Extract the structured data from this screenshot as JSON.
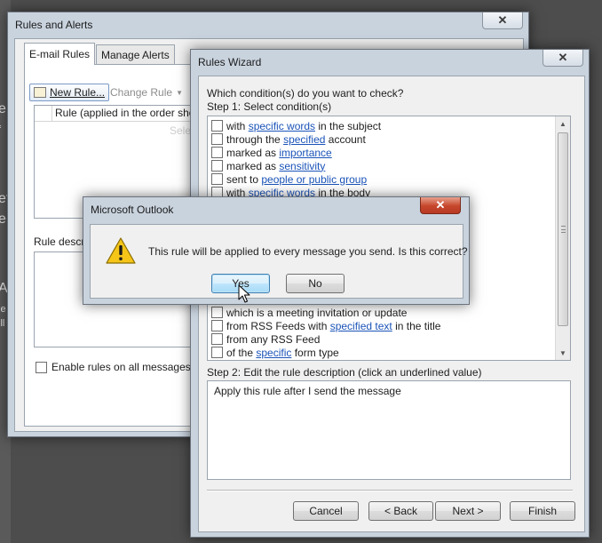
{
  "background_fragments": [
    "e",
    "f",
    "et",
    "e",
    "A",
    "le",
    "ill"
  ],
  "rules_alerts": {
    "title": "Rules and Alerts",
    "tabs": [
      "E-mail Rules",
      "Manage Alerts"
    ],
    "new_rule": "New Rule...",
    "change_rule": "Change Rule",
    "rule_column_header": "Rule (applied in the order shown)",
    "faded_text": "Select",
    "description_label": "Rule descrip",
    "enable_label": "Enable rules on all messages dow"
  },
  "wizard": {
    "title": "Rules Wizard",
    "question": "Which condition(s) do you want to check?",
    "step1": "Step 1: Select condition(s)",
    "conditions": [
      {
        "pre": "with ",
        "link": "specific words",
        "post": " in the subject"
      },
      {
        "pre": "through the ",
        "link": "specified",
        "post": " account"
      },
      {
        "pre": "marked as ",
        "link": "importance",
        "post": ""
      },
      {
        "pre": "marked as ",
        "link": "sensitivity",
        "post": ""
      },
      {
        "pre": "sent to ",
        "link": "people or public group",
        "post": ""
      },
      {
        "pre": "with ",
        "link": "specific words",
        "post": " in the body"
      },
      {
        "pre": "which is a meeting invitation or update",
        "link": "",
        "post": ""
      },
      {
        "pre": "from RSS Feeds with ",
        "link": "specified text",
        "post": " in the title"
      },
      {
        "pre": "from any RSS Feed",
        "link": "",
        "post": ""
      },
      {
        "pre": "of the ",
        "link": "specific",
        "post": " form type"
      }
    ],
    "step2": "Step 2: Edit the rule description (click an underlined value)",
    "rule_description": "Apply this rule after I send the message",
    "buttons": {
      "cancel": "Cancel",
      "back": "< Back",
      "next": "Next >",
      "finish": "Finish"
    }
  },
  "msgbox": {
    "title": "Microsoft Outlook",
    "message": "This rule will be applied to every message you send. Is this correct?",
    "yes": "Yes",
    "no": "No",
    "icon": "warning-icon"
  }
}
